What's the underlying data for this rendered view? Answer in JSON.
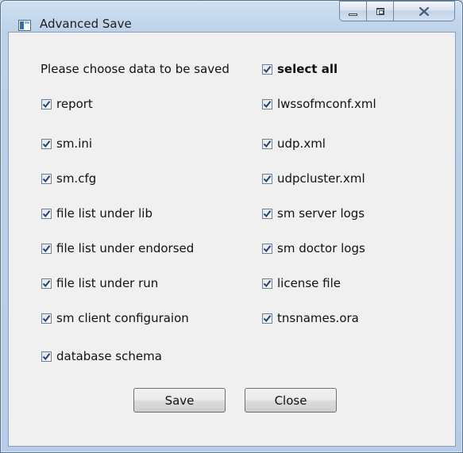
{
  "window": {
    "title": "Advanced Save"
  },
  "prompt": "Please choose data to be saved",
  "select_all": {
    "label": "select all",
    "checked": true
  },
  "left_items": [
    {
      "label": "report",
      "checked": true
    },
    {
      "label": "sm.ini",
      "checked": true
    },
    {
      "label": "sm.cfg",
      "checked": true
    },
    {
      "label": "file list under lib",
      "checked": true
    },
    {
      "label": "file list under endorsed",
      "checked": true
    },
    {
      "label": "file list under run",
      "checked": true
    },
    {
      "label": "sm client configuraion",
      "checked": true
    },
    {
      "label": "database schema",
      "checked": true
    }
  ],
  "right_items": [
    {
      "label": "lwssofmconf.xml",
      "checked": true
    },
    {
      "label": "udp.xml",
      "checked": true
    },
    {
      "label": "udpcluster.xml",
      "checked": true
    },
    {
      "label": "sm server logs",
      "checked": true
    },
    {
      "label": "sm doctor logs",
      "checked": true
    },
    {
      "label": "license file",
      "checked": true
    },
    {
      "label": "tnsnames.ora",
      "checked": true
    }
  ],
  "buttons": {
    "save": "Save",
    "close": "Close"
  },
  "icons": {
    "app": "app-window-icon",
    "minimize": "minimize-icon",
    "maximize": "maximize-icon",
    "close": "close-icon",
    "check": "checkmark-icon"
  }
}
